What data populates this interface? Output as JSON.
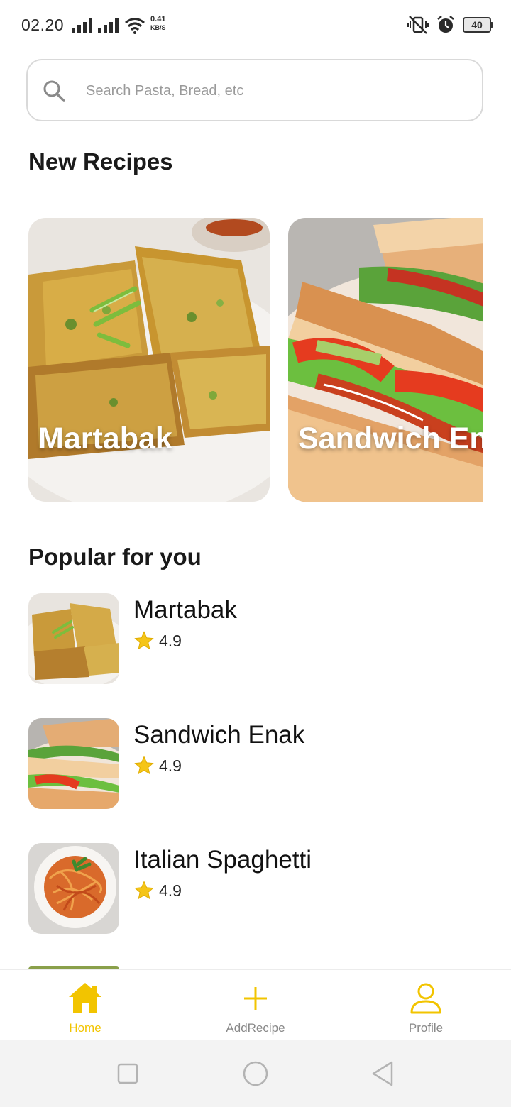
{
  "status_bar": {
    "time": "02.20",
    "net_speed_value": "0.41",
    "net_speed_unit": "KB/S",
    "battery_level": "40"
  },
  "search": {
    "placeholder": "Search Pasta, Bread, etc"
  },
  "sections": {
    "new_recipes_title": "New Recipes",
    "popular_title": "Popular for you"
  },
  "new_recipes": [
    {
      "title": "Martabak",
      "image": "martabak"
    },
    {
      "title": "Sandwich Enak",
      "image": "sandwich"
    }
  ],
  "popular": [
    {
      "name": "Martabak",
      "rating": "4.9",
      "image": "martabak"
    },
    {
      "name": "Sandwich Enak",
      "rating": "4.9",
      "image": "sandwich"
    },
    {
      "name": "Italian Spaghetti",
      "rating": "4.9",
      "image": "spaghetti"
    }
  ],
  "bottom_nav": {
    "items": [
      {
        "label": "Home",
        "icon": "home-icon",
        "active": true
      },
      {
        "label": "AddRecipe",
        "icon": "plus-icon",
        "active": false
      },
      {
        "label": "Profile",
        "icon": "user-icon",
        "active": false
      }
    ]
  },
  "colors": {
    "accent": "#F2C400",
    "star": "#F5C518",
    "inactive": "#888888"
  }
}
